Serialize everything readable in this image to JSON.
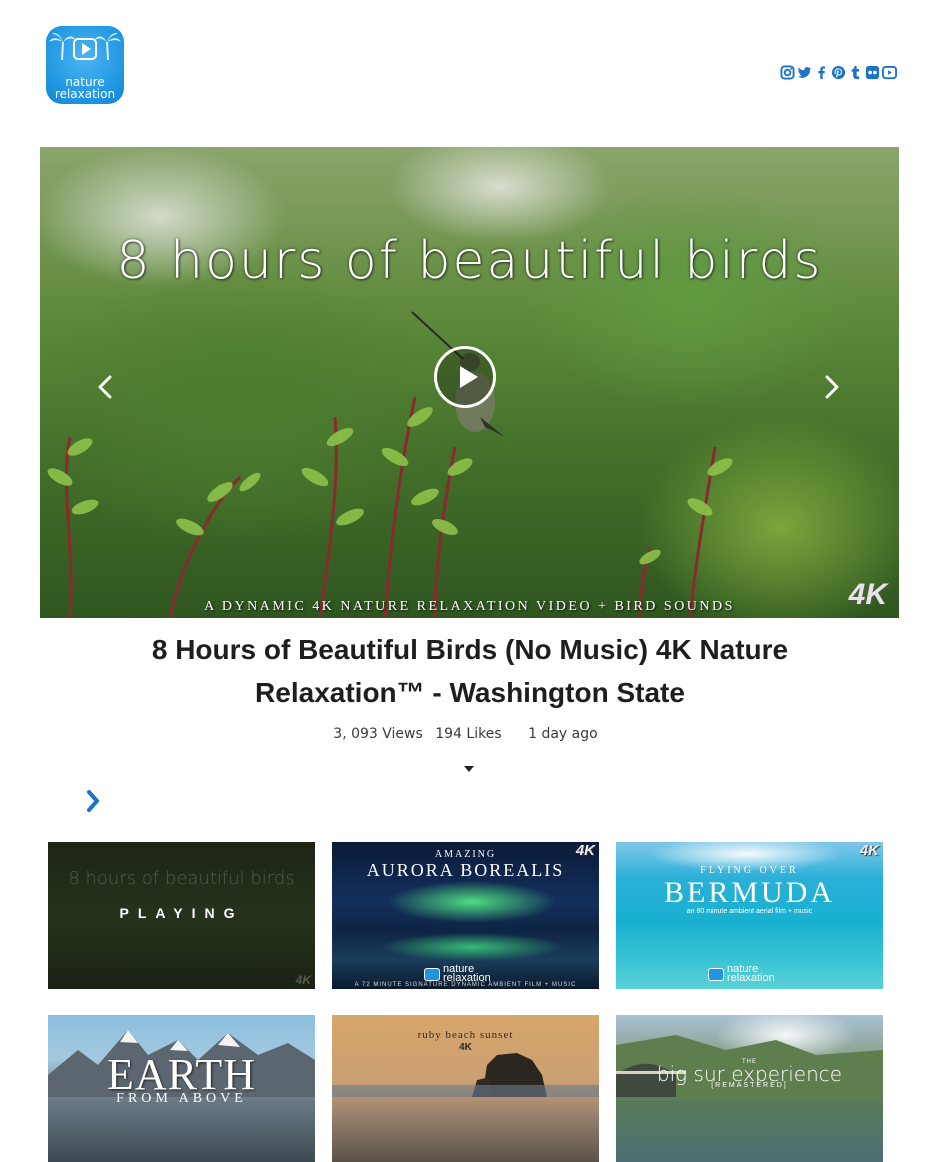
{
  "brand": {
    "logo_line1": "nature",
    "logo_line2": "relaxation",
    "accent_color": "#1a73c8"
  },
  "social": {
    "icons": [
      "instagram-icon",
      "twitter-icon",
      "facebook-icon",
      "pinterest-icon",
      "tumblr-icon",
      "flickr-icon",
      "youtube-icon"
    ]
  },
  "hero": {
    "title_overlay": "8 hours of beautiful birds",
    "subtitle_overlay": "A DYNAMIC 4K NATURE RELAXATION VIDEO + BIRD SOUNDS",
    "badge": "4K",
    "prev_icon": "chevron-left-icon",
    "next_icon": "chevron-right-icon",
    "play_icon": "play-icon"
  },
  "video": {
    "title": "8 Hours of Beautiful Birds (No Music) 4K Nature Relaxation™ - Washington State",
    "views": "3, 093 Views",
    "likes": "194 Likes",
    "posted": "1 day ago"
  },
  "grid": {
    "thumbs": [
      {
        "overlay": "8 hours of beautiful birds",
        "status": "PLAYING",
        "badge": "4K"
      },
      {
        "small": "AMAZING",
        "big": "AURORA BOREALIS",
        "badge": "4K",
        "logo1": "nature",
        "logo2": "relaxation",
        "bottom": "A 72 MINUTE SIGNATURE DYNAMIC AMBIENT FILM + MUSIC"
      },
      {
        "small": "FLYING OVER",
        "big": "BERMUDA",
        "tiny": "an 80 minute ambient aerial film + music",
        "badge": "4K",
        "logo1": "nature",
        "logo2": "relaxation"
      },
      {
        "big": "EARTH",
        "big2": "FROM ABOVE"
      },
      {
        "small": "ruby beach sunset",
        "badge": "4K"
      },
      {
        "tiny": "THE",
        "big": "big sur experience",
        "big2": "[REMASTERED]"
      }
    ]
  }
}
